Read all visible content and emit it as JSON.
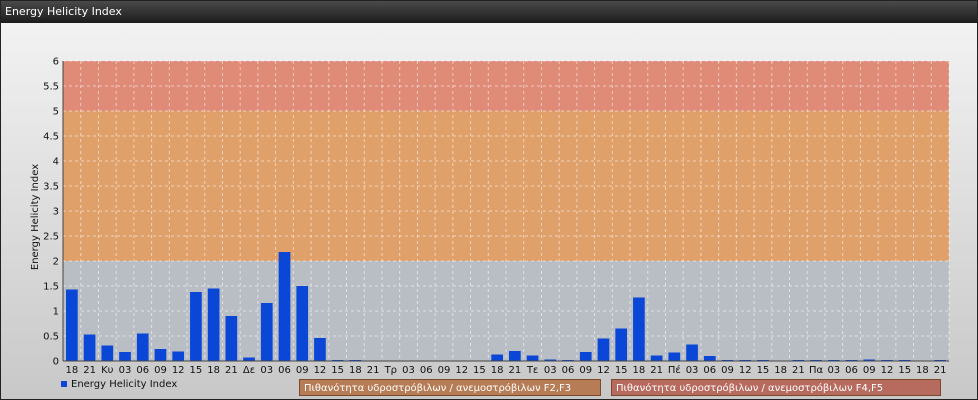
{
  "window": {
    "title": "Energy Helicity Index"
  },
  "colors": {
    "bar": "#0a47d6",
    "band_low": "#b9bec4",
    "band_mid": "#e0a06a",
    "band_high": "#e08a78"
  },
  "bands": [
    {
      "label": "Πιθανότητα υδροστρόβιλων / ανεμοστρόβιλων F2,F3",
      "from": 2,
      "to": 5
    },
    {
      "label": "Πιθανότητα υδροστρόβιλων / ανεμοστρόβιλων F4,F5",
      "from": 5,
      "to": 6
    }
  ],
  "chart_data": {
    "type": "bar",
    "ylabel": "Energy Helicity Index",
    "ylim": [
      0,
      6
    ],
    "yticks": [
      "0",
      "0.5",
      "1",
      "1.5",
      "2",
      "2.5",
      "3",
      "3.5",
      "4",
      "4.5",
      "5",
      "5.5",
      "6"
    ],
    "grid": true,
    "legend": "bottom-left",
    "categories": [
      "18",
      "21",
      "Κυ",
      "03",
      "06",
      "09",
      "12",
      "15",
      "18",
      "21",
      "Δε",
      "03",
      "06",
      "09",
      "12",
      "15",
      "18",
      "21",
      "Τρ",
      "03",
      "06",
      "09",
      "12",
      "15",
      "18",
      "21",
      "Τε",
      "03",
      "06",
      "09",
      "12",
      "15",
      "18",
      "21",
      "Πέ",
      "03",
      "06",
      "09",
      "12",
      "15",
      "18",
      "21",
      "Πα",
      "03",
      "06",
      "09",
      "12",
      "15",
      "18",
      "21"
    ],
    "series": [
      {
        "name": "Energy Helicity Index",
        "values": [
          1.43,
          0.53,
          0.31,
          0.18,
          0.55,
          0.24,
          0.19,
          1.38,
          1.45,
          0.9,
          0.07,
          1.16,
          2.18,
          1.5,
          0.46,
          0.02,
          0.02,
          0.01,
          0.01,
          0.01,
          0.01,
          0.01,
          0.01,
          0.01,
          0.13,
          0.2,
          0.11,
          0.03,
          0.02,
          0.18,
          0.45,
          0.65,
          1.27,
          0.11,
          0.17,
          0.33,
          0.1,
          0.02,
          0.02,
          0.02,
          0.01,
          0.02,
          0.02,
          0.02,
          0.02,
          0.03,
          0.02,
          0.02,
          0.01,
          0.02
        ]
      }
    ]
  }
}
